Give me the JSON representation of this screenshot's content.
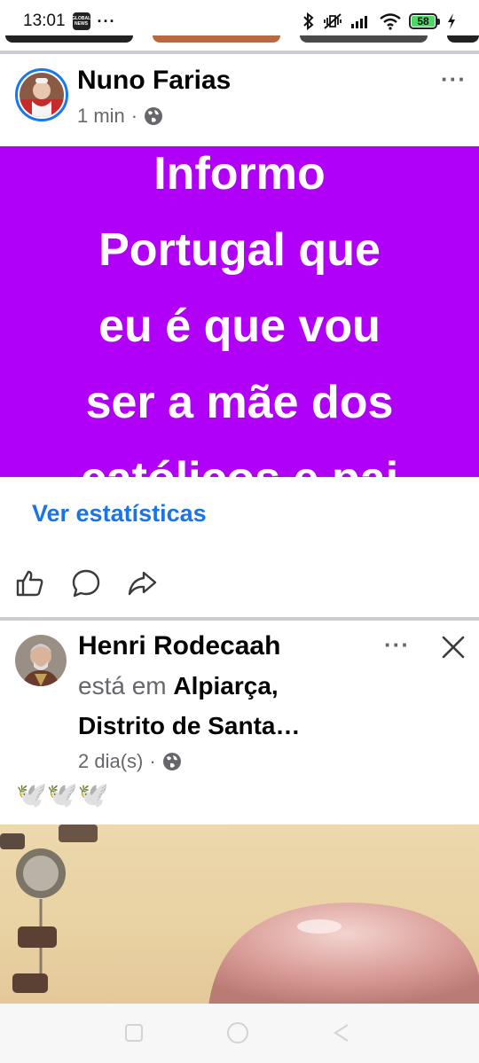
{
  "status_bar": {
    "time": "13:01",
    "news_badge": "GLOBAL NEWS",
    "overflow": "···",
    "battery": "58",
    "icons": [
      "bluetooth-icon",
      "mute-vibrate-icon",
      "signal-icon",
      "wifi-icon",
      "battery-icon",
      "charging-icon"
    ]
  },
  "post1": {
    "author": "Nuno Farias",
    "time": "1 min",
    "separator": "·",
    "audience_icon": "globe-icon",
    "more": "···",
    "background_color": "#b000f7",
    "text_lines": [
      "Informo",
      "Portugal que",
      "eu é que vou",
      "ser a mãe dos",
      "católicos e pai"
    ],
    "stats_link": "Ver estatísticas",
    "actions": [
      "like-icon",
      "comment-icon",
      "share-icon"
    ]
  },
  "post2": {
    "author": "Henri  Rodecaah",
    "is_at": "está em",
    "location_line1": "Alpiarça,",
    "location_line2": "Distrito de Santa…",
    "time": "2 dia(s)",
    "separator": "·",
    "audience_icon": "globe-icon",
    "more": "···",
    "close": "close-icon",
    "emoji_text": "🕊️🕊️🕊️"
  },
  "nav_bar": {
    "buttons": [
      "recents-button",
      "home-button",
      "back-button"
    ]
  },
  "colors": {
    "accent": "#1b74e4",
    "purple_post": "#b000f7",
    "secondary_text": "#65676b"
  }
}
